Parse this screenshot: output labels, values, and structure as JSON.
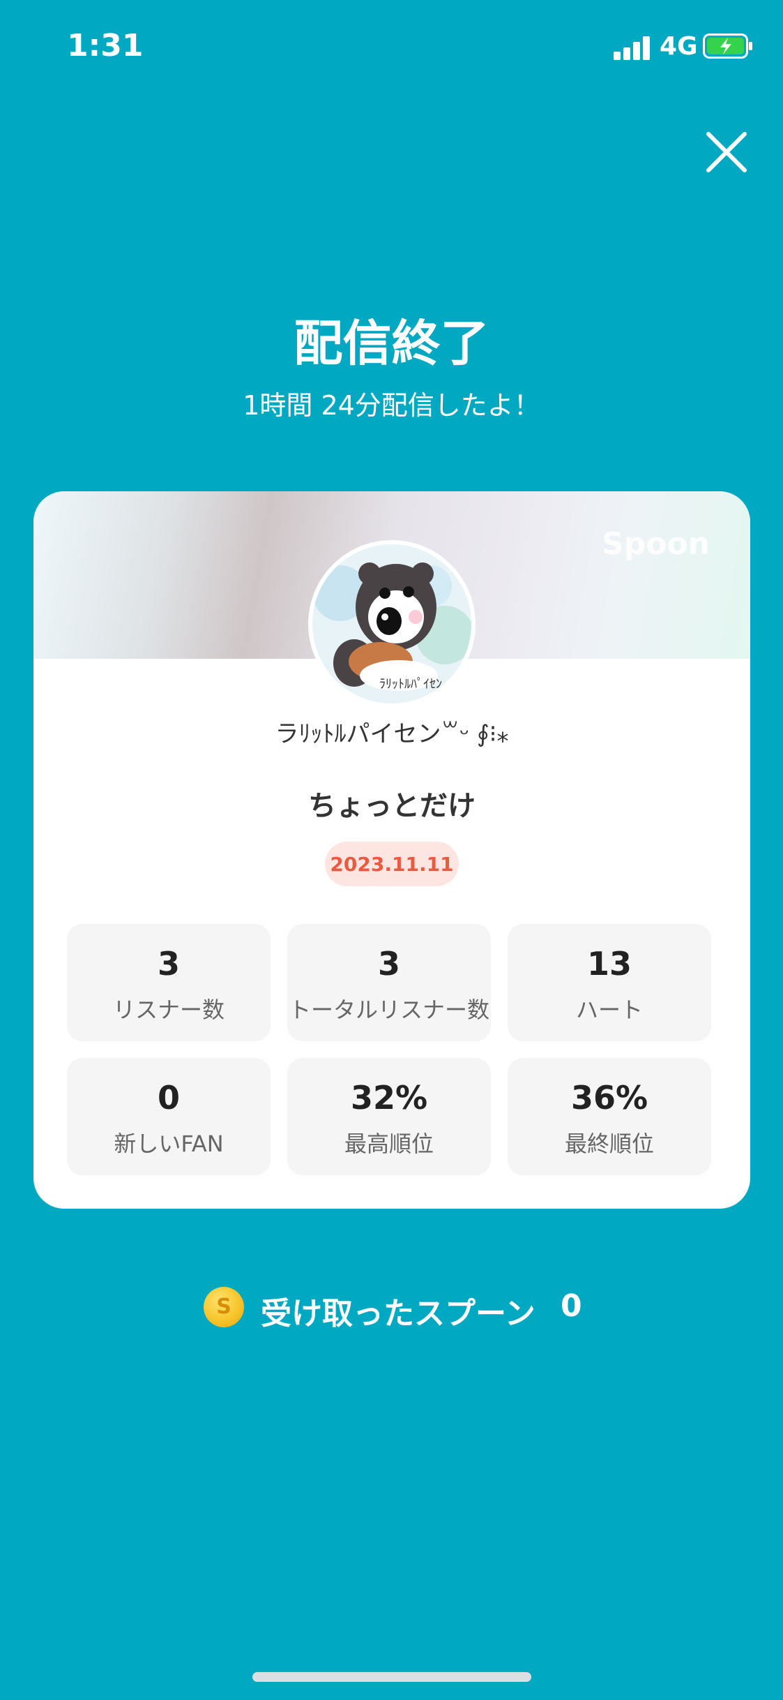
{
  "status_bar": {
    "time": "1:31",
    "network": "4G",
    "battery_color": "#35d34d"
  },
  "header": {
    "title": "配信終了",
    "subtitle": "1時間 24分配信したよ！"
  },
  "card": {
    "brand": "Spoon",
    "nickname": "ラﾘｯﾄﾙパイセン꒳ᵕ ∮⁝⁎",
    "live_title": "ちょっとだけ",
    "date": "2023.11.11",
    "stats": [
      {
        "value": "3",
        "label": "リスナー数"
      },
      {
        "value": "3",
        "label": "トータルリスナー数"
      },
      {
        "value": "13",
        "label": "ハート"
      },
      {
        "value": "0",
        "label": "新しいFAN"
      },
      {
        "value": "32%",
        "label": "最高順位"
      },
      {
        "value": "36%",
        "label": "最終順位"
      }
    ]
  },
  "spoons": {
    "coin_symbol": "S",
    "label": "受け取ったスプーン",
    "count": "0"
  },
  "colors": {
    "background": "#00a8c2",
    "date_badge_text": "#ea5a3f",
    "date_badge_bg": "#fde6e2"
  },
  "icons": {
    "close": "close-icon",
    "coin": "coin-icon"
  }
}
